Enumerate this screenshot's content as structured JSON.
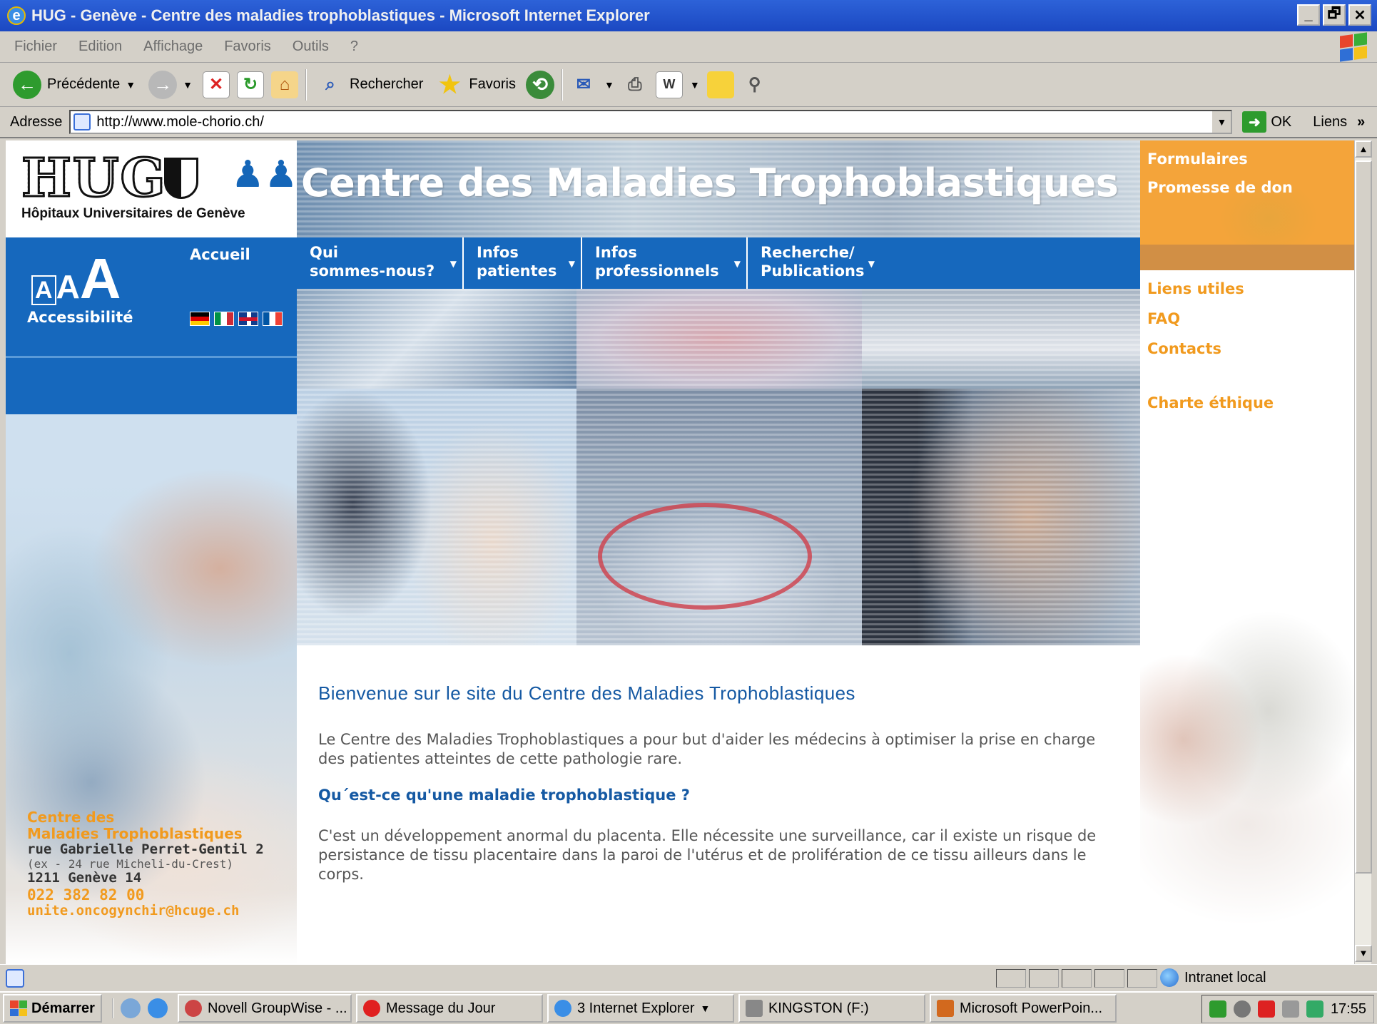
{
  "window": {
    "title": "HUG - Genève - Centre des maladies trophoblastiques - Microsoft Internet Explorer",
    "controls": [
      "_",
      "🗗",
      "✕"
    ]
  },
  "menu": [
    "Fichier",
    "Edition",
    "Affichage",
    "Favoris",
    "Outils",
    "?"
  ],
  "toolbar": {
    "back_label": "Précédente",
    "search_label": "Rechercher",
    "favorites_label": "Favoris"
  },
  "address": {
    "label": "Adresse",
    "url": "http://www.mole-chorio.ch/",
    "go_label": "OK",
    "links_label": "Liens",
    "links_chevron": "»"
  },
  "site": {
    "logo_text": "HUG",
    "logo_subtitle": "Hôpitaux Universitaires de Genève",
    "banner_title": "Centre des Maladies Trophoblastiques",
    "accueil": "Accueil",
    "accessibilite": "Accessibilité",
    "nav": [
      {
        "line1": "Qui",
        "line2": "sommes-nous?"
      },
      {
        "line1": "Infos",
        "line2": "patientes"
      },
      {
        "line1": "Infos",
        "line2": "professionnels"
      },
      {
        "line1": "Recherche/",
        "line2": "Publications"
      }
    ],
    "right_links_top": [
      "Formulaires",
      "Promesse de don"
    ],
    "right_links": [
      "Liens utiles",
      "FAQ",
      "Contacts"
    ],
    "charte": "Charte éthique",
    "welcome": "Bienvenue sur le site du Centre des Maladies Trophoblastiques",
    "intro": "Le Centre des Maladies Trophoblastiques a pour but d'aider les médecins à optimiser la prise en charge des patientes atteintes de cette pathologie rare.",
    "question": "Qu´est-ce qu'une maladie trophoblastique ?",
    "answer": "C'est un développement anormal du placenta. Elle nécessite une surveillance, car il existe un risque de persistance de tissu placentaire dans la paroi de l'utérus et de prolifération de ce tissu ailleurs dans le corps.",
    "contact": {
      "name1": "Centre des",
      "name2": "Maladies Trophoblastiques",
      "street": "rue Gabrielle Perret-Gentil 2",
      "former": "(ex - 24 rue Micheli-du-Crest)",
      "city": "1211 Genève 14",
      "phone": "022 382 82 00",
      "email": "unite.oncogynchir@hcuge.ch"
    }
  },
  "statusbar": {
    "zone": "Intranet local"
  },
  "taskbar": {
    "start": "Démarrer",
    "tasks": [
      "Novell GroupWise - ...",
      "Message du Jour",
      "3 Internet Explorer",
      "KINGSTON (F:)",
      "Microsoft PowerPoin..."
    ],
    "clock": "17:55"
  },
  "colors": {
    "hug_blue": "#1668bd",
    "orange": "#f19a1e",
    "heading_blue": "#1559a3"
  }
}
